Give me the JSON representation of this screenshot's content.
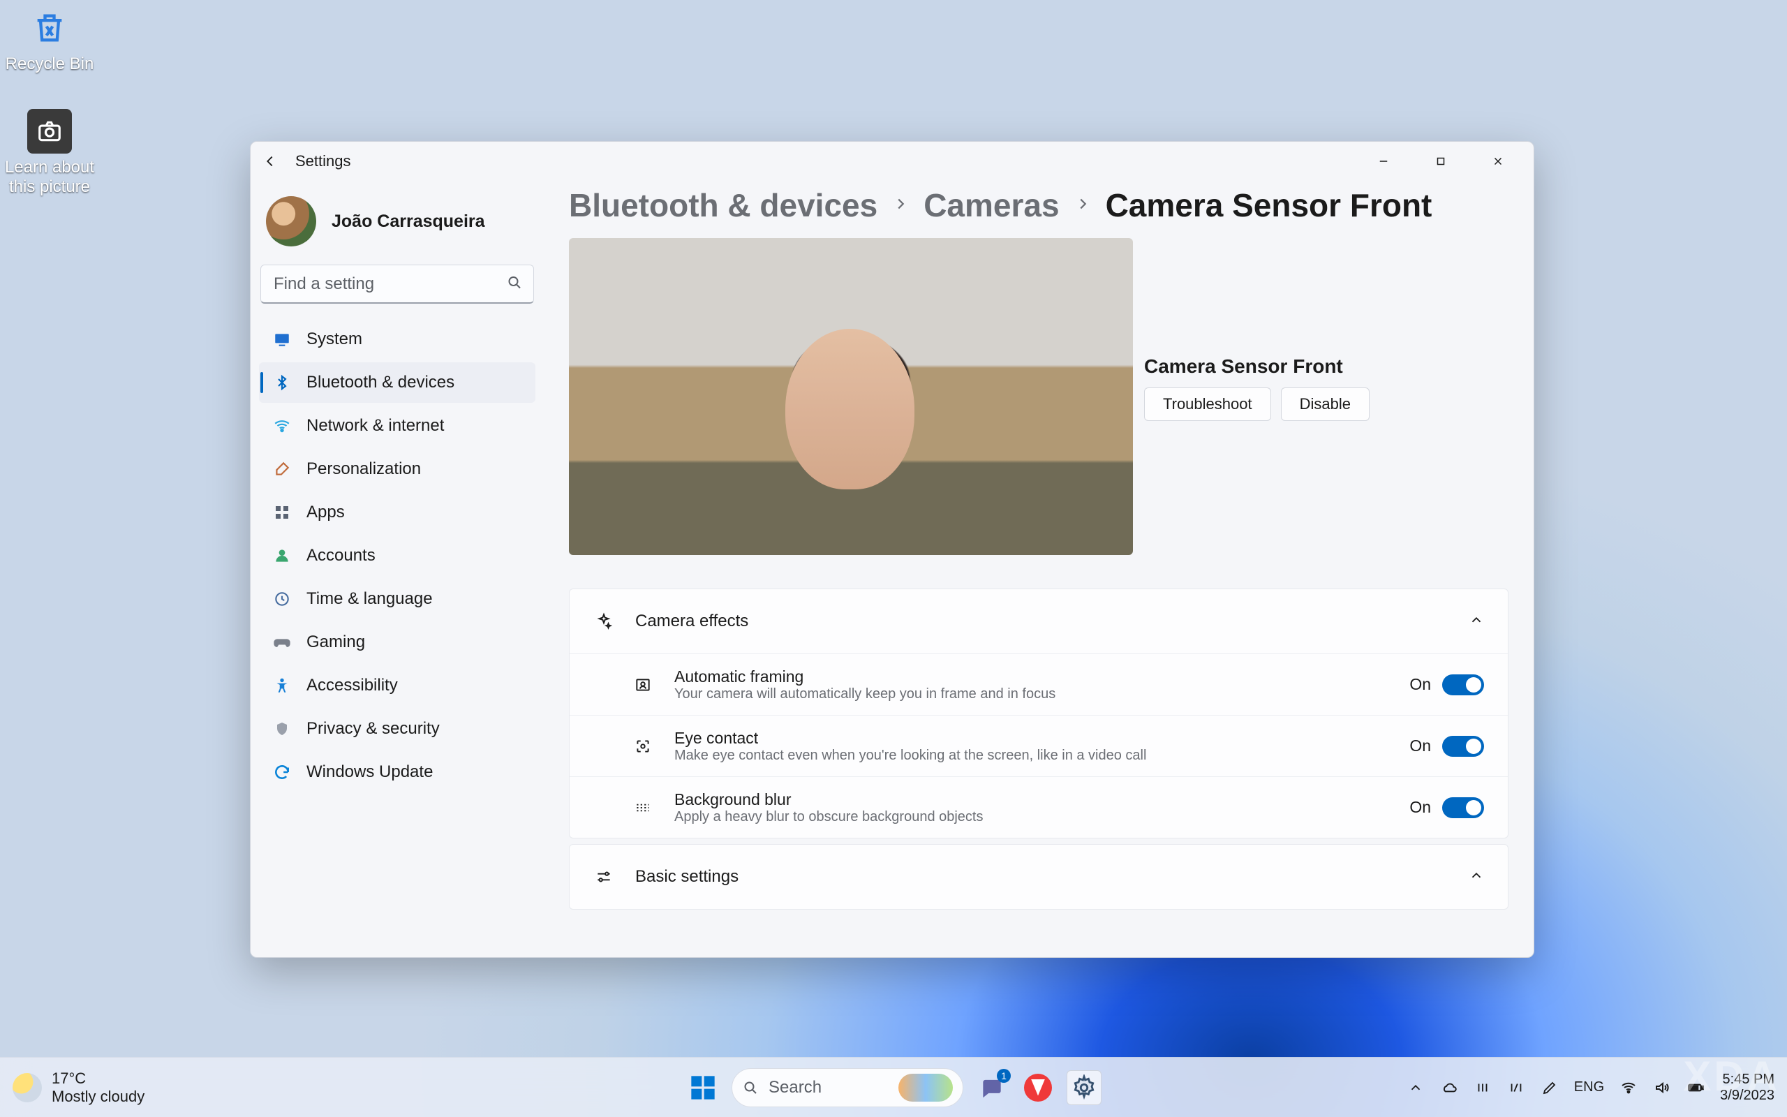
{
  "desktop_icons": {
    "recycle": "Recycle Bin",
    "learn": "Learn about this picture"
  },
  "window": {
    "title": "Settings"
  },
  "user": {
    "name": "João Carrasqueira"
  },
  "search": {
    "placeholder": "Find a setting"
  },
  "nav": {
    "system": "System",
    "bluetooth": "Bluetooth & devices",
    "network": "Network & internet",
    "personalization": "Personalization",
    "apps": "Apps",
    "accounts": "Accounts",
    "time": "Time & language",
    "gaming": "Gaming",
    "accessibility": "Accessibility",
    "privacy": "Privacy & security",
    "update": "Windows Update"
  },
  "breadcrumb": {
    "l1": "Bluetooth & devices",
    "l2": "Cameras",
    "current": "Camera Sensor Front"
  },
  "camera": {
    "name": "Camera Sensor Front",
    "troubleshoot": "Troubleshoot",
    "disable": "Disable"
  },
  "effects": {
    "header": "Camera effects",
    "auto_framing": {
      "title": "Automatic framing",
      "desc": "Your camera will automatically keep you in frame and in focus",
      "state": "On"
    },
    "eye_contact": {
      "title": "Eye contact",
      "desc": "Make eye contact even when you're looking at the screen, like in a video call",
      "state": "On"
    },
    "bg_blur": {
      "title": "Background blur",
      "desc": "Apply a heavy blur to obscure background objects",
      "state": "On"
    }
  },
  "basic": {
    "header": "Basic settings"
  },
  "taskbar": {
    "search": "Search",
    "chat_badge": "1",
    "weather_temp": "17°C",
    "weather_cond": "Mostly cloudy",
    "lang": "ENG",
    "time": "5:45 PM",
    "date": "3/9/2023"
  },
  "watermark": "XDA"
}
